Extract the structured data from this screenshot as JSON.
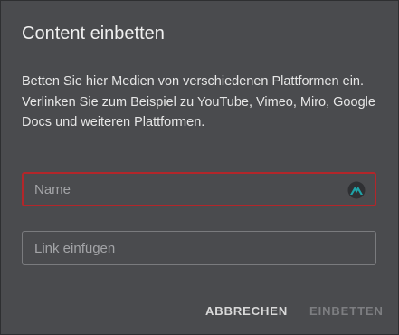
{
  "dialog": {
    "title": "Content einbetten",
    "description": "Betten Sie hier Medien von verschiedenen Plattformen ein. Verlinken Sie zum Beispiel zu YouTube, Vimeo, Miro, Google Docs und weiteren Plattformen.",
    "name_field": {
      "placeholder": "Name",
      "value": "",
      "border_color": "#b3262a",
      "icon": "password-manager-icon",
      "icon_color": "#1fa3a8"
    },
    "link_field": {
      "placeholder": "Link einfügen",
      "value": ""
    },
    "actions": {
      "cancel_label": "ABBRECHEN",
      "embed_label": "EINBETTEN",
      "embed_disabled": true
    }
  },
  "colors": {
    "background": "#4a4b4e",
    "error": "#b3262a",
    "disabled_text": "#7d7e81"
  }
}
